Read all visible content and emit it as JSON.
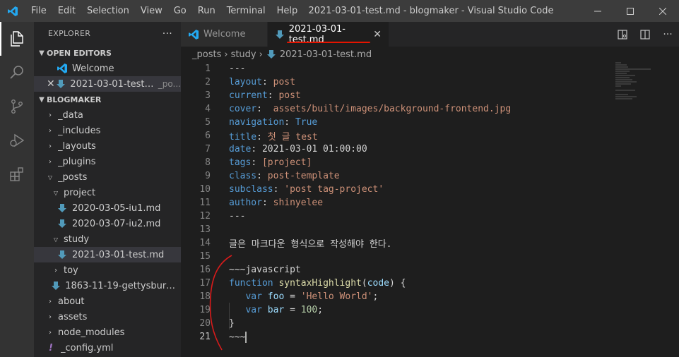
{
  "window": {
    "title": "2021-03-01-test.md - blogmaker - Visual Studio Code",
    "menu": [
      "File",
      "Edit",
      "Selection",
      "View",
      "Go",
      "Run",
      "Terminal",
      "Help"
    ]
  },
  "sidebar": {
    "header": "EXPLORER",
    "more": "···",
    "open_editors": {
      "title": "OPEN EDITORS",
      "items": [
        {
          "label": "Welcome",
          "desc": ""
        },
        {
          "label": "2021-03-01-test.md",
          "desc": "_po..."
        }
      ]
    },
    "project": {
      "title": "BLOGMAKER",
      "items": [
        {
          "label": "_data"
        },
        {
          "label": "_includes"
        },
        {
          "label": "_layouts"
        },
        {
          "label": "_plugins"
        },
        {
          "label": "_posts"
        },
        {
          "label": "project"
        },
        {
          "label": "2020-03-05-iu1.md"
        },
        {
          "label": "2020-03-07-iu2.md"
        },
        {
          "label": "study"
        },
        {
          "label": "2021-03-01-test.md"
        },
        {
          "label": "toy"
        },
        {
          "label": "1863-11-19-gettysburg-ad..."
        },
        {
          "label": "about"
        },
        {
          "label": "assets"
        },
        {
          "label": "node_modules"
        },
        {
          "label": "_config.yml"
        }
      ]
    }
  },
  "tabs": [
    {
      "label": "Welcome"
    },
    {
      "label": "2021-03-01-test.md"
    }
  ],
  "breadcrumb": [
    "_posts",
    "study",
    "2021-03-01-test.md"
  ],
  "code": {
    "line_numbers": [
      "1",
      "2",
      "3",
      "4",
      "5",
      "6",
      "7",
      "8",
      "9",
      "10",
      "11",
      "12",
      "13",
      "14",
      "15",
      "16",
      "17",
      "18",
      "19",
      "20",
      "21"
    ],
    "l1": "---",
    "l2k": "layout",
    "l2v": "post",
    "l3k": "current",
    "l3v": "post",
    "l4k": "cover",
    "l4v": "assets/built/images/background-frontend.jpg",
    "l5k": "navigation",
    "l5v": "True",
    "l6k": "title",
    "l6v": "첫 글 test",
    "l7k": "date",
    "l7v": "2021-03-01 01:00:00",
    "l8k": "tags",
    "l8v": "[project]",
    "l9k": "class",
    "l9v": "post-template",
    "l10k": "subclass",
    "l10v": "'post tag-project'",
    "l11k": "author",
    "l11v": "shinyelee",
    "l12": "---",
    "l14": "글은 마크다운 형식으로 작성해야 한다.",
    "l16": "~~~javascript",
    "l17a": "function",
    "l17b": "syntaxHighlight",
    "l17c": "code",
    "l18a": "var",
    "l18b": "foo",
    "l18c": "'Hello World'",
    "l19a": "var",
    "l19b": "bar",
    "l19c": "100",
    "l20": "}",
    "l21": "~~~"
  }
}
